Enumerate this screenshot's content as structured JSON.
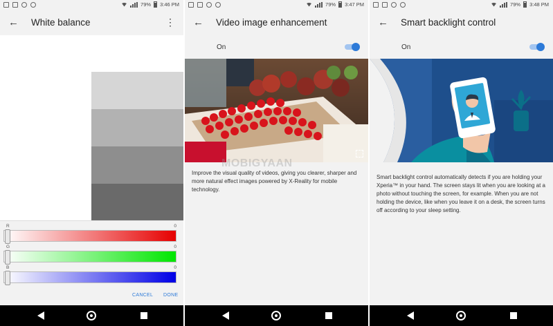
{
  "status_bar": {
    "battery": "79%",
    "times": [
      "3:46 PM",
      "3:47 PM",
      "3:48 PM"
    ]
  },
  "white_balance": {
    "title": "White balance",
    "channels": [
      {
        "label": "R",
        "value": "0",
        "color": "#e60000"
      },
      {
        "label": "G",
        "value": "0",
        "color": "#00e600"
      },
      {
        "label": "B",
        "value": "0",
        "color": "#0000e6"
      }
    ],
    "swatch_colors": [
      "#d6d6d6",
      "#b2b2b2",
      "#8e8e8e",
      "#6a6a6a"
    ],
    "cancel_label": "CANCEL",
    "done_label": "DONE"
  },
  "video_enhancement": {
    "title": "Video image enhancement",
    "toggle_label": "On",
    "toggle_on": true,
    "description": "Improve the visual quality of videos, giving you clearer, sharper and more natural effect images powered by X-Reality for mobile technology.",
    "watermark": "MOBIGYAAN"
  },
  "smart_backlight": {
    "title": "Smart backlight control",
    "toggle_label": "On",
    "toggle_on": true,
    "description": "Smart backlight control automatically detects if you are holding your Xperia™ in your hand. The screen stays lit when you are looking at a photo without touching the screen, for example. When you are not holding the device, like when you leave it on a desk, the screen turns off according to your sleep setting."
  },
  "colors": {
    "accent": "#2d7ad8",
    "bar_bg": "#f2f2f2",
    "nav_bg": "#000000"
  },
  "icons": [
    "back-arrow-icon",
    "more-vert-icon",
    "nav-back-icon",
    "nav-home-icon",
    "nav-recents-icon",
    "fullscreen-icon"
  ]
}
